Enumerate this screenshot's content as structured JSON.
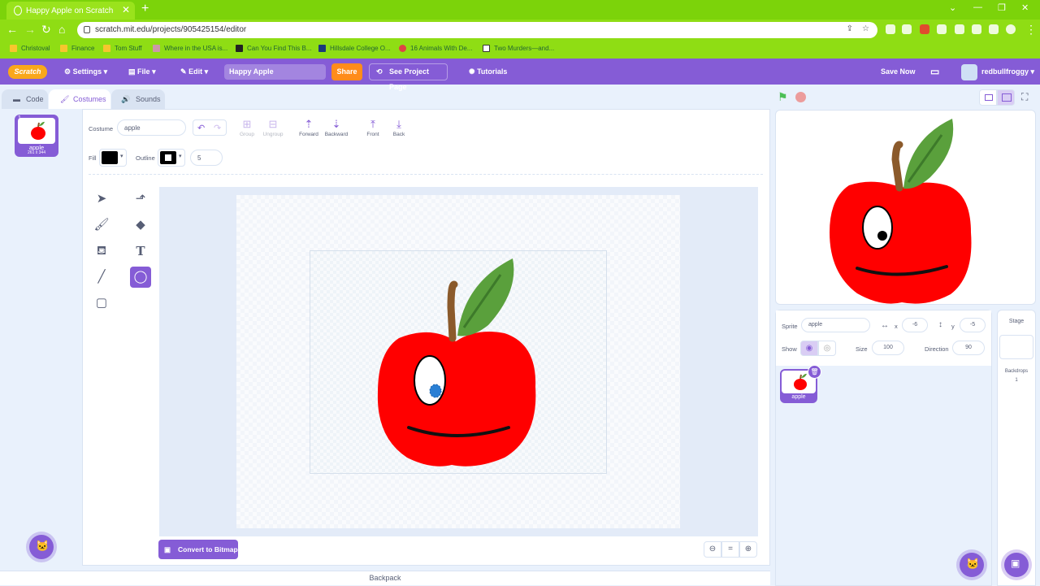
{
  "browser": {
    "tab_title": "Happy Apple on Scratch",
    "url": "scratch.mit.edu/projects/905425154/editor",
    "bookmarks": [
      "Christoval",
      "Finance",
      "Tom Stuff",
      "Where in the USA is...",
      "Can You Find This B...",
      "Hillsdale College O...",
      "16 Animals With De...",
      "Two Murders—and..."
    ]
  },
  "menubar": {
    "logo": "Scratch",
    "settings": "Settings",
    "file": "File",
    "edit": "Edit",
    "project_title": "Happy Apple",
    "share": "Share",
    "see_project": "See Project Page",
    "tutorials": "Tutorials",
    "save_now": "Save Now",
    "username": "redbullfroggy"
  },
  "tabs": {
    "code": "Code",
    "costumes": "Costumes",
    "sounds": "Sounds"
  },
  "costume_list": [
    {
      "number": "1",
      "name": "apple",
      "size": "261 x 344"
    }
  ],
  "editor": {
    "costume_label": "Costume",
    "costume_name": "apple",
    "group": "Group",
    "ungroup": "Ungroup",
    "forward": "Forward",
    "backward": "Backward",
    "front": "Front",
    "back": "Back",
    "fill_label": "Fill",
    "outline_label": "Outline",
    "outline_width": "5",
    "fill_color": "#000000",
    "outline_color": "#000000",
    "convert_button": "Convert to Bitmap",
    "selected_tool": "ellipse",
    "zoom_reset": "="
  },
  "sprite_info": {
    "sprite_label": "Sprite",
    "sprite_name": "apple",
    "x_label": "x",
    "x": "-6",
    "y_label": "y",
    "y": "-5",
    "show_label": "Show",
    "size_label": "Size",
    "size": "100",
    "direction_label": "Direction",
    "direction": "90"
  },
  "sprites": [
    {
      "name": "apple"
    }
  ],
  "stage_pane": {
    "title": "Stage",
    "backdrops_label": "Backdrops",
    "backdrops_count": "1"
  },
  "backpack": "Backpack",
  "colors": {
    "accent": "#855cd6",
    "share": "#ff8c1a",
    "apple_red": "#ff0000",
    "leaf": "#5aa03c",
    "stem": "#8b5a2b"
  }
}
